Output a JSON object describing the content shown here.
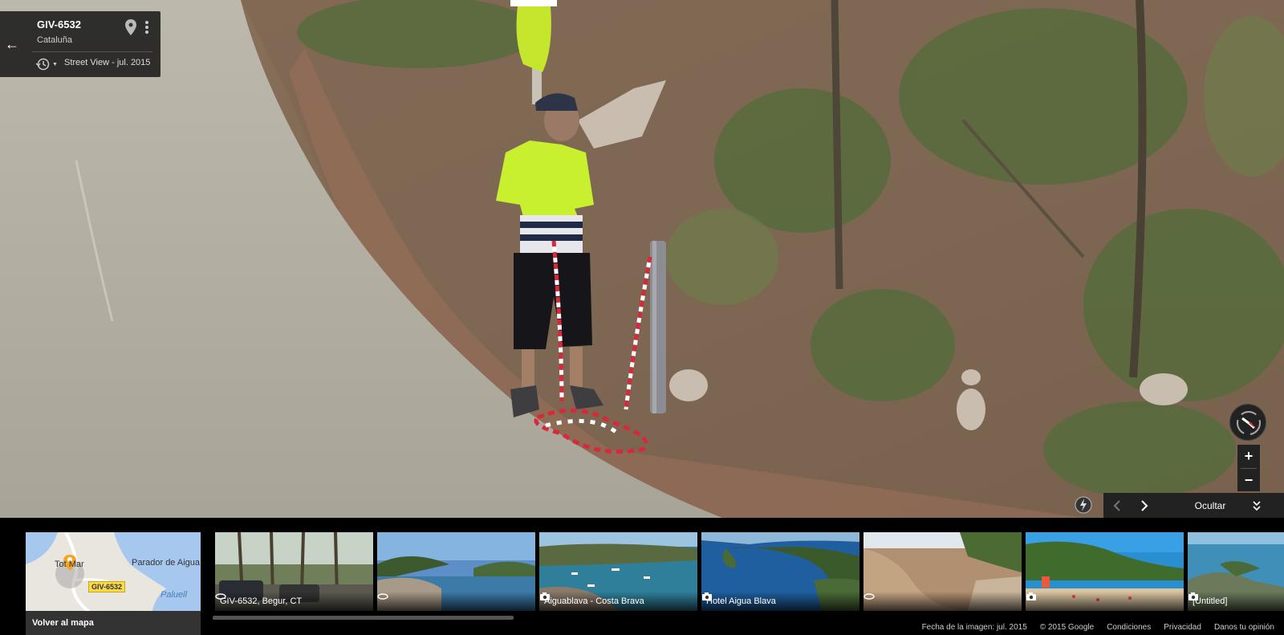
{
  "location": {
    "title": "GIV-6532",
    "region": "Cataluña",
    "history_label": "Street View - jul. 2015"
  },
  "icons": {
    "back": "←",
    "zoom_in": "+",
    "zoom_out": "−"
  },
  "nav": {
    "hide_label": "Ocultar"
  },
  "minimap": {
    "label_town": "Tot Mar",
    "label_parador": "Parador de Aigua",
    "label_paluell": "Paluell",
    "badge": "GIV-6532",
    "back_label": "Volver al mapa"
  },
  "thumbnails": [
    {
      "label": "GIV-6532, Begur, CT",
      "icon": "pano-icon"
    },
    {
      "label": "",
      "icon": "pano-icon"
    },
    {
      "label": "Aiguablava - Costa Brava",
      "icon": "camera-icon"
    },
    {
      "label": "Hotel Aigua Blava",
      "icon": "camera-icon"
    },
    {
      "label": "",
      "icon": "pano-icon"
    },
    {
      "label": "",
      "icon": "camera-icon"
    },
    {
      "label": "[Untitled]",
      "icon": "camera-icon"
    }
  ],
  "footer": {
    "date": "Fecha de la imagen: jul. 2015",
    "copyright": "© 2015 Google",
    "terms": "Condiciones",
    "privacy": "Privacidad",
    "feedback": "Danos tu opinión"
  }
}
